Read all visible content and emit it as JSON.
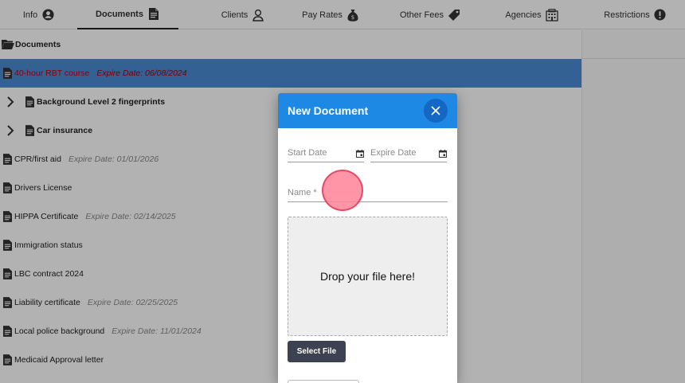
{
  "tabs": [
    {
      "label": "Info",
      "icon": "account-circle-icon"
    },
    {
      "label": "Documents",
      "icon": "document-icon",
      "active": true
    },
    {
      "label": "Clients",
      "icon": "person-icon"
    },
    {
      "label": "Pay Rates",
      "icon": "money-bag-icon"
    },
    {
      "label": "Other Fees",
      "icon": "tag-icon"
    },
    {
      "label": "Agencies",
      "icon": "building-icon"
    },
    {
      "label": "Restrictions",
      "icon": "alert-circle-icon"
    }
  ],
  "documents": {
    "header": "Documents",
    "rows": [
      {
        "name": "40-hour RBT course",
        "expire": "Expire Date: 06/08/2024",
        "selected": true
      },
      {
        "name": "Background Level 2 fingerprints",
        "expire": "",
        "folder": true
      },
      {
        "name": "Car insurance",
        "expire": "",
        "folder": true
      },
      {
        "name": "CPR/first aid",
        "expire": "Expire Date: 01/01/2026"
      },
      {
        "name": "Drivers License",
        "expire": ""
      },
      {
        "name": "HIPPA Certificate",
        "expire": "Expire Date: 02/14/2025"
      },
      {
        "name": "Immigration status",
        "expire": ""
      },
      {
        "name": "LBC contract 2024",
        "expire": ""
      },
      {
        "name": "Liability certificate",
        "expire": "Expire Date: 02/25/2025"
      },
      {
        "name": "Local police background",
        "expire": "Expire Date: 11/01/2024"
      },
      {
        "name": "Medicaid Approval letter",
        "expire": ""
      }
    ]
  },
  "modal": {
    "title": "New Document",
    "start_date_placeholder": "Start Date",
    "expire_date_placeholder": "Expire Date",
    "name_placeholder": "Name *",
    "dropzone_text": "Drop your file here!",
    "select_file_label": "Select File"
  },
  "colors": {
    "primary": "#1e88e5",
    "selected_row": "#4a8bd4",
    "select_button": "#3d4252"
  }
}
